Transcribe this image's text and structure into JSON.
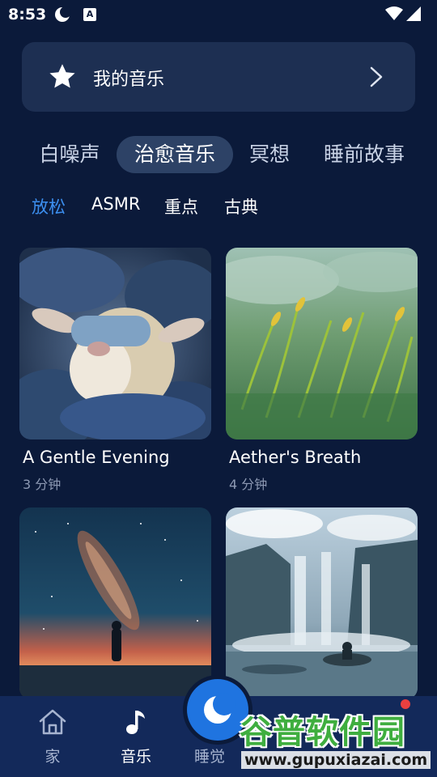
{
  "status_bar": {
    "time": "8:53",
    "icons": [
      "moon-icon",
      "a-icon",
      "wifi-icon",
      "battery-icon"
    ]
  },
  "my_music": {
    "label": "我的音乐",
    "icon": "star-icon",
    "chevron": "chevron-right-icon"
  },
  "category_tabs": [
    {
      "label": "白噪声",
      "active": false
    },
    {
      "label": "治愈音乐",
      "active": true
    },
    {
      "label": "冥想",
      "active": false
    },
    {
      "label": "睡前故事",
      "active": false
    }
  ],
  "sub_tabs": [
    {
      "label": "放松",
      "active": true
    },
    {
      "label": "ASMR",
      "active": false
    },
    {
      "label": "重点",
      "active": false
    },
    {
      "label": "古典",
      "active": false
    }
  ],
  "cards": [
    {
      "title": "A Gentle Evening",
      "duration": "3 分钟",
      "image": "sheep-with-sleep-mask"
    },
    {
      "title": "Aether's Breath",
      "duration": "4 分钟",
      "image": "misty-grass"
    },
    {
      "title": "",
      "duration": "",
      "image": "milky-way-figure"
    },
    {
      "title": "",
      "duration": "",
      "image": "waterfall-lake"
    }
  ],
  "bottom_nav": {
    "items": [
      {
        "label": "家",
        "icon": "home-icon",
        "active": false
      },
      {
        "label": "音乐",
        "icon": "music-note-icon",
        "active": true
      },
      {
        "label": "睡觉",
        "icon": "moon-icon",
        "active": false
      }
    ]
  },
  "watermark": {
    "main": "谷普软件园",
    "url": "www.gupuxiazai.com"
  },
  "colors": {
    "background": "#0b1a3a",
    "card": "#1d2f52",
    "accent": "#3c8ff0",
    "fab": "#1f74e0",
    "nav": "#13295a"
  }
}
